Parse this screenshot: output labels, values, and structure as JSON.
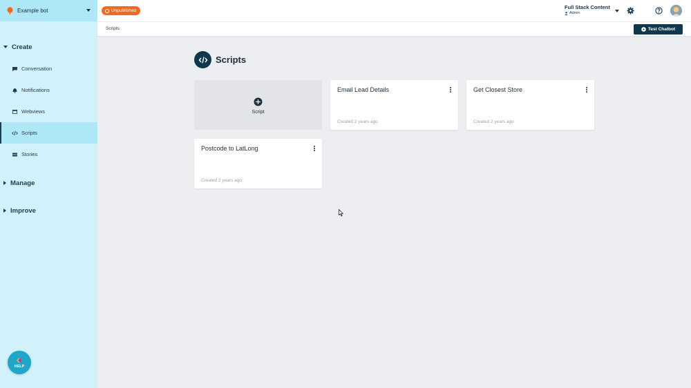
{
  "sidebar": {
    "bot_name": "Example bot",
    "sections": {
      "create": "Create",
      "manage": "Manage",
      "improve": "Improve"
    },
    "items": [
      {
        "label": "Conversation",
        "icon": "chat-icon"
      },
      {
        "label": "Notifications",
        "icon": "bell-icon"
      },
      {
        "label": "Webviews",
        "icon": "window-icon"
      },
      {
        "label": "Scripts",
        "icon": "code-icon"
      },
      {
        "label": "Stories",
        "icon": "stories-icon"
      }
    ],
    "active_item": "Scripts",
    "help_label": "HELP"
  },
  "topbar": {
    "status": "Unpublished",
    "status_color": "#f4681f",
    "account_name": "Full Stack Content",
    "account_role": "Admin"
  },
  "subbar": {
    "breadcrumb": "Scripts",
    "test_button": "Test Chatbot"
  },
  "main": {
    "title": "Scripts",
    "add_label": "Script",
    "cards": [
      {
        "title": "Email Lead Details",
        "created": "Created 2 years ago"
      },
      {
        "title": "Get Closest Store",
        "created": "Created 2 years ago"
      },
      {
        "title": "Postcode to LatLong",
        "created": "Created 2 years ago"
      }
    ]
  },
  "colors": {
    "brand_dark": "#10384d",
    "sidebar_bg": "#d2f2fb",
    "sidebar_active": "#aee7f6",
    "help_button": "#1fa6c9"
  }
}
